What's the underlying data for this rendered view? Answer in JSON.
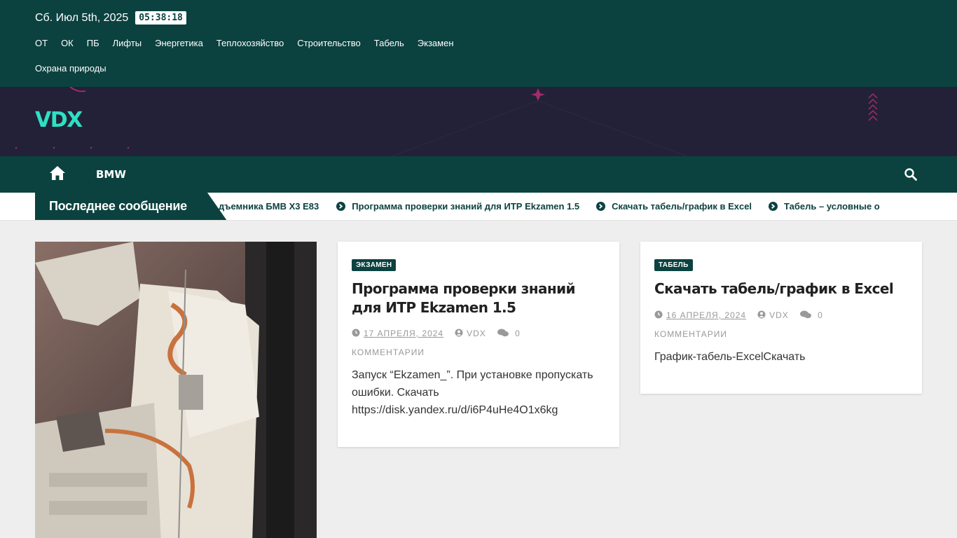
{
  "topbar": {
    "date": "Сб. Июл 5th, 2025",
    "clock": "05:38:18",
    "menu": [
      "ОТ",
      "ОК",
      "ПБ",
      "Лифты",
      "Энергетика",
      "Теплохозяйство",
      "Строительство",
      "Табель",
      "Экзамен",
      "Охрана природы"
    ]
  },
  "brand": {
    "logo": "VDX"
  },
  "nav": {
    "home_icon": "home-icon",
    "item": "BMW",
    "search_icon": "search-icon"
  },
  "ticker": {
    "label": "Последнее сообщение",
    "items": [
      "дъемника БМВ Х3 Е83",
      "Программа проверки знаний для ИТР Ekzamen 1.5",
      "Скачать табель/график в Excel",
      "Табель – условные о"
    ]
  },
  "posts": [
    {
      "category": "ЭКЗАМЕН",
      "title": "Программа проверки знаний для ИТР Ekzamen 1.5",
      "date": "17 АПРЕЛЯ, 2024",
      "author": "VDX",
      "comments_count": "0",
      "comments_label": "КОММЕНТАРИИ",
      "excerpt": "Запуск “Ekzamen_”. При установке пропускать ошибки. Скачать https://disk.yandex.ru/d/i6P4uHe4O1x6kg"
    },
    {
      "category": "ТАБЕЛЬ",
      "title": "Скачать табель/график в Excel",
      "date": "16 АПРЕЛЯ, 2024",
      "author": "VDX",
      "comments_count": "0",
      "comments_label": "КОММЕНТАРИИ",
      "excerpt": "График-табель-ExcelСкачать"
    }
  ],
  "colors": {
    "primary": "#0b4240",
    "brand_bg": "#222138",
    "logo": "#2ee0c4",
    "page_bg": "#eeeeee"
  }
}
